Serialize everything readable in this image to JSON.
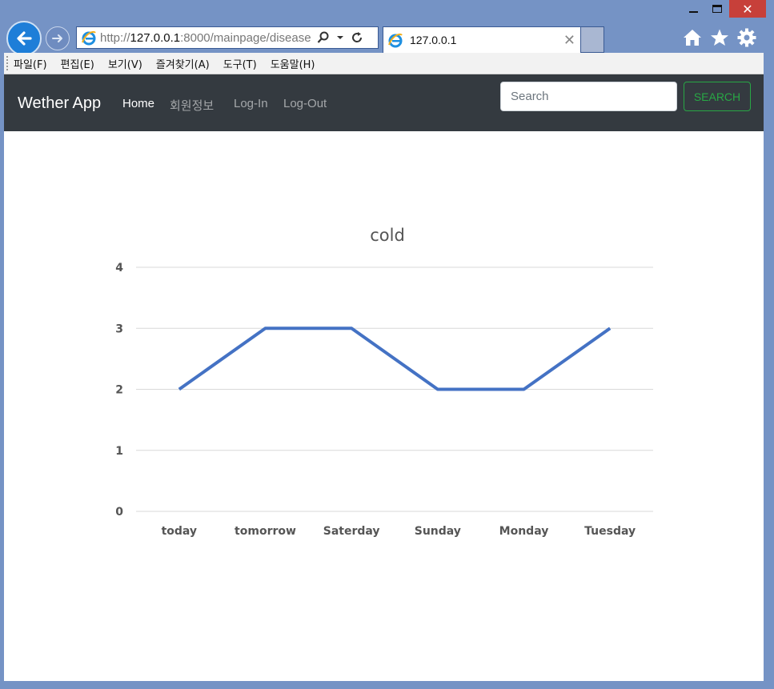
{
  "browser": {
    "address_scheme": "http://",
    "address_host": "127.0.0.1",
    "address_rest": ":8000/mainpage/disease",
    "tab_title": "127.0.0.1",
    "menu": [
      "파일(F)",
      "편집(E)",
      "보기(V)",
      "즐겨찾기(A)",
      "도구(T)",
      "도움말(H)"
    ]
  },
  "navbar": {
    "brand": "Wether App",
    "links": [
      "Home",
      "회원정보",
      "Log-In",
      "Log-Out"
    ],
    "search_placeholder": "Search",
    "search_button": "SEARCH"
  },
  "chart_data": {
    "type": "line",
    "title": "cold",
    "categories": [
      "today",
      "tomorrow",
      "Saterday",
      "Sunday",
      "Monday",
      "Tuesday"
    ],
    "values": [
      2,
      3,
      3,
      2,
      2,
      3
    ],
    "ylim": [
      0,
      4
    ],
    "yticks": [
      0,
      1,
      2,
      3,
      4
    ],
    "grid": true,
    "line_color": "#4472c4"
  }
}
